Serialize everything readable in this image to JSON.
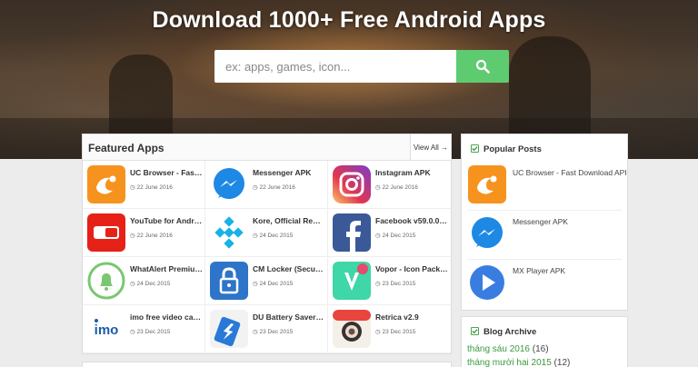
{
  "hero": {
    "title": "Download 1000+ Free Android Apps",
    "search_placeholder": "ex: apps, games, icon..."
  },
  "featured": {
    "title": "Featured Apps",
    "view_all": "View All →",
    "apps": [
      {
        "name": "UC Browser - Fast D...",
        "date": "22 June 2016",
        "icon": "uc-browser-icon"
      },
      {
        "name": "Messenger APK",
        "date": "22 June 2016",
        "icon": "messenger-icon"
      },
      {
        "name": "Instagram APK",
        "date": "22 June 2016",
        "icon": "instagram-icon"
      },
      {
        "name": "YouTube for Android...",
        "date": "22 June 2016",
        "icon": "youtube-icon"
      },
      {
        "name": "Kore, Official Remot...",
        "date": "24 Dec 2015",
        "icon": "kodi-icon"
      },
      {
        "name": "Facebook v59.0.0.0....",
        "date": "24 Dec 2015",
        "icon": "facebook-icon"
      },
      {
        "name": "WhatAlert Premium ...",
        "date": "24 Dec 2015",
        "icon": "bell-icon"
      },
      {
        "name": "CM Locker (Secure &...",
        "date": "24 Dec 2015",
        "icon": "lock-icon"
      },
      {
        "name": "Vopor - Icon Pack v5....",
        "date": "23 Dec 2015",
        "icon": "vopor-icon"
      },
      {
        "name": "imo free video calls a...",
        "date": "23 Dec 2015",
        "icon": "imo-icon"
      },
      {
        "name": "DU Battery Saver&P...",
        "date": "23 Dec 2015",
        "icon": "battery-icon"
      },
      {
        "name": "Retrica v2.9",
        "date": "23 Dec 2015",
        "icon": "camera-icon"
      }
    ]
  },
  "popular": {
    "title": "Popular Posts",
    "items": [
      {
        "name": "UC Browser - Fast Download APK",
        "icon": "uc-browser-icon"
      },
      {
        "name": "Messenger APK",
        "icon": "messenger-icon"
      },
      {
        "name": "MX Player APK",
        "icon": "play-icon"
      }
    ]
  },
  "archive": {
    "title": "Blog Archive",
    "items": [
      {
        "label": "tháng sáu 2016",
        "count": "(16)"
      },
      {
        "label": "tháng mười hai 2015",
        "count": "(12)"
      }
    ]
  },
  "colors": {
    "accent_green": "#5fcb71",
    "link_green": "#3b9a3f"
  }
}
